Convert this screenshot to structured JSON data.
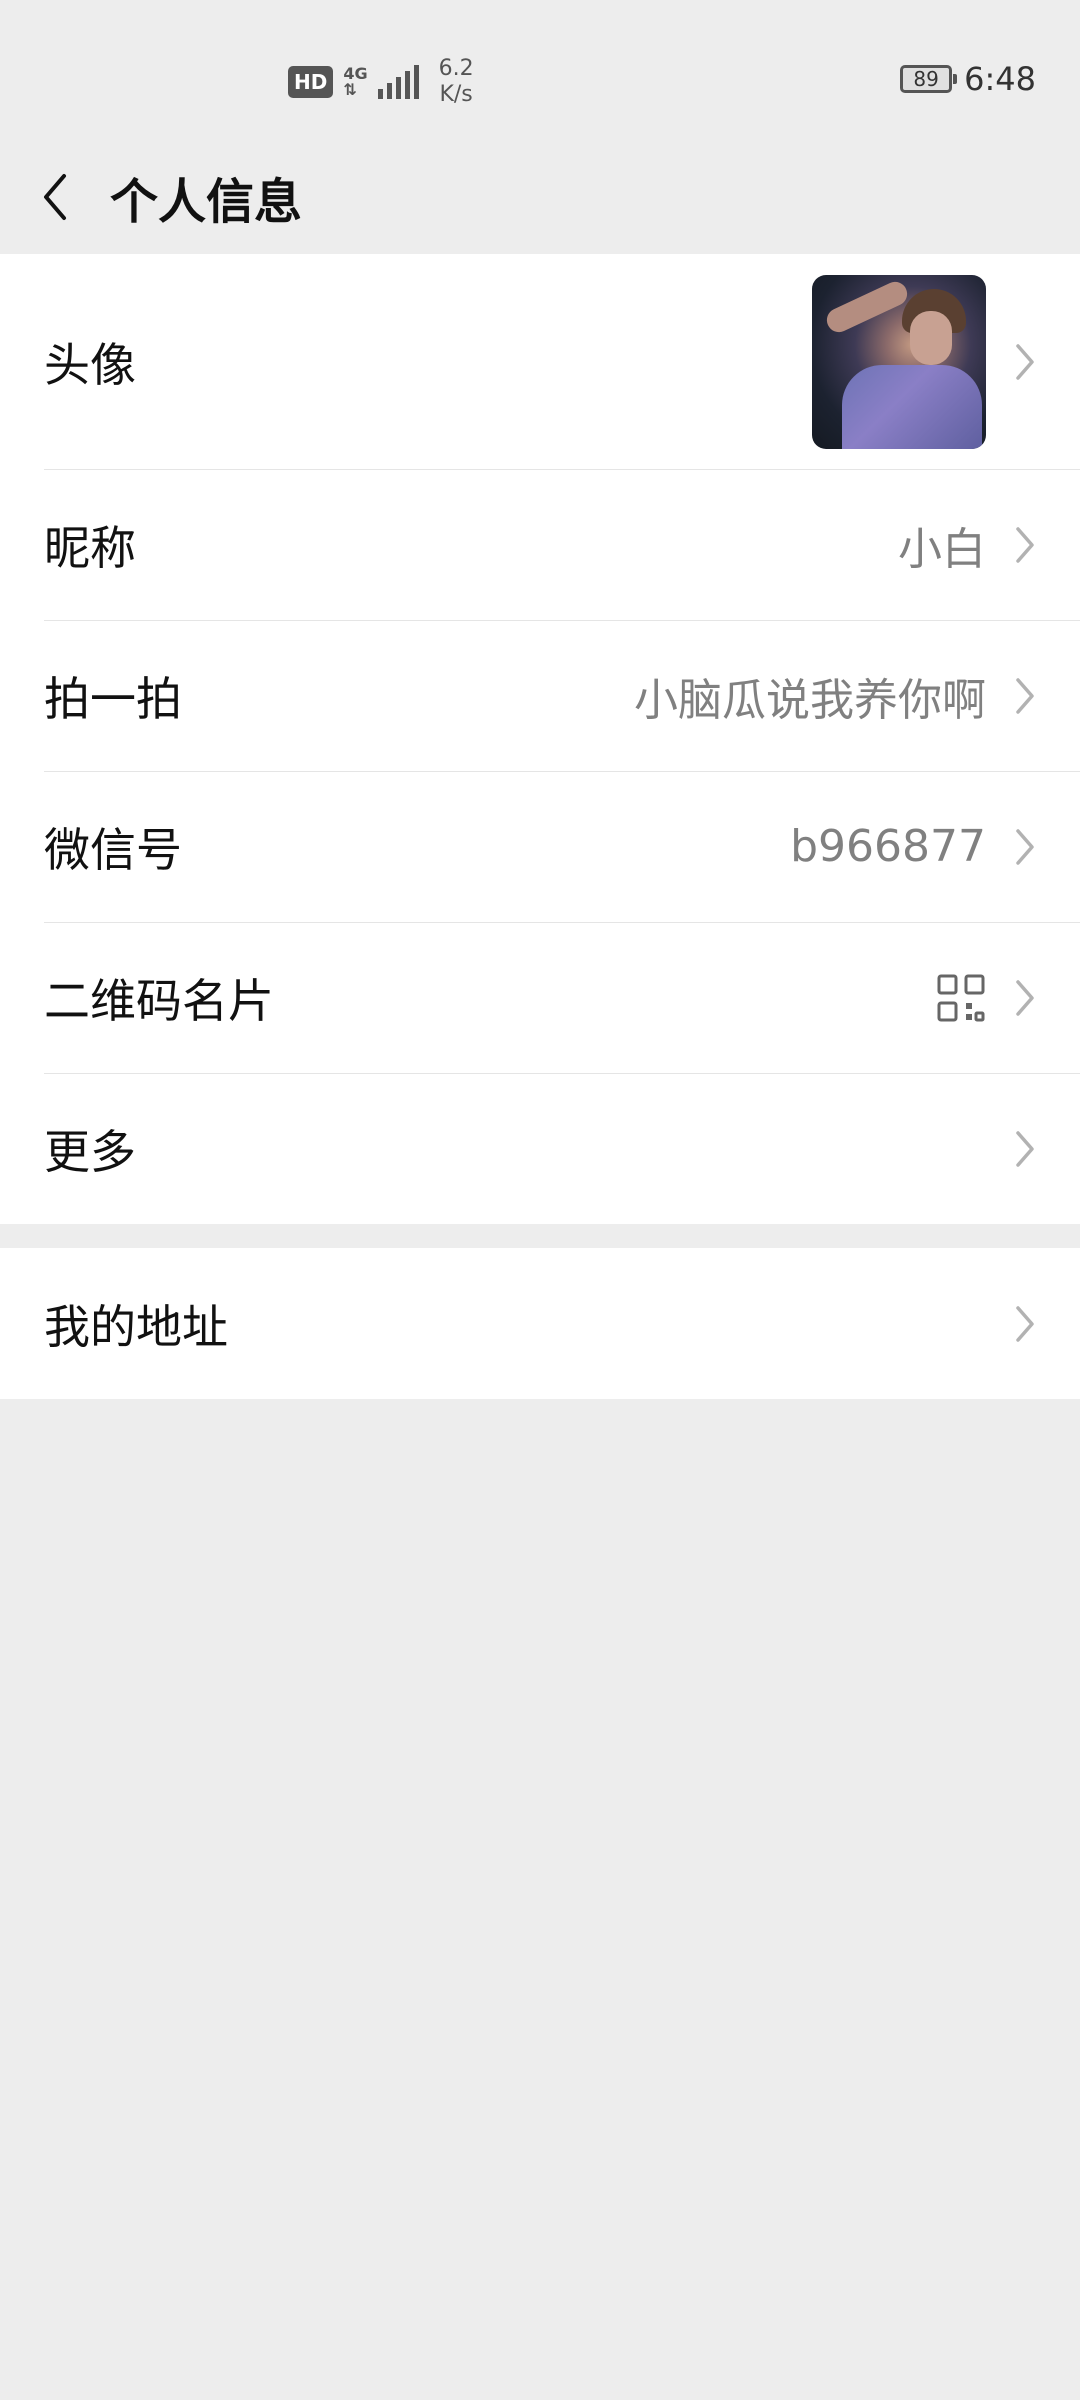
{
  "status_bar": {
    "hd": "HD",
    "network": "4G",
    "speed_value": "6.2",
    "speed_unit": "K/s",
    "battery": "89",
    "time": "6:48"
  },
  "header": {
    "title": "个人信息"
  },
  "profile": {
    "avatar_label": "头像",
    "nickname_label": "昵称",
    "nickname_value": "小白",
    "pat_label": "拍一拍",
    "pat_value": "小脑瓜说我养你啊",
    "wechat_id_label": "微信号",
    "wechat_id_value": "b966877",
    "qr_label": "二维码名片",
    "more_label": "更多"
  },
  "address": {
    "label": "我的地址"
  },
  "icons": {
    "back": "back-arrow-icon",
    "chevron": "chevron-right-icon",
    "qr": "qr-code-icon"
  },
  "colors": {
    "background": "#ededed",
    "row_background": "#ffffff",
    "secondary_text": "#808080",
    "chevron": "#b2b2b2"
  }
}
